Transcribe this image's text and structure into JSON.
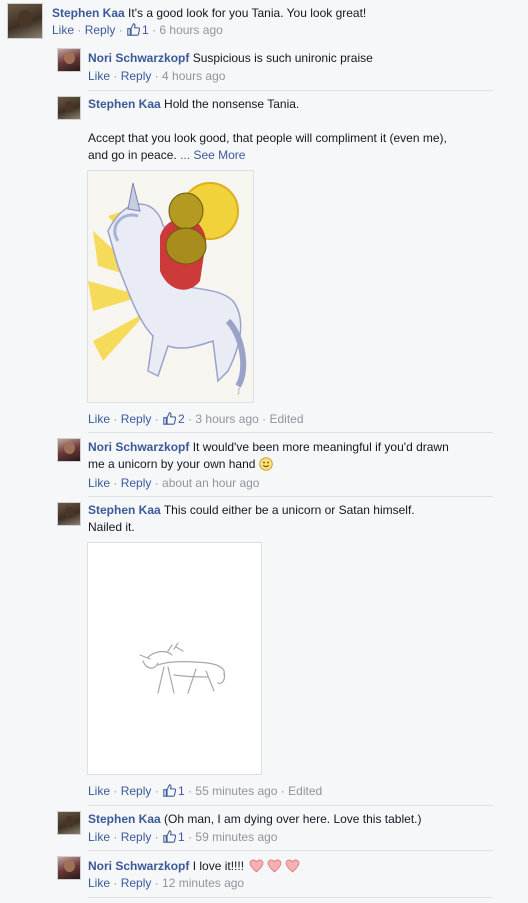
{
  "comments": [
    {
      "author": "Stephen Kaa",
      "text": "It's a good look for you Tania. You look great!",
      "like": "Like",
      "reply": "Reply",
      "likes": "1",
      "time": "6 hours ago"
    },
    {
      "author": "Nori Schwarzkopf",
      "text": "Suspicious is such unironic praise",
      "like": "Like",
      "reply": "Reply",
      "time": "4 hours ago"
    },
    {
      "author": "Stephen Kaa",
      "text": "Hold the nonsense Tania.",
      "text2": "Accept that you look good, that people will compliment it (even me),",
      "text3": "and go in peace.",
      "ellipsis": "...",
      "see_more": "See More",
      "like": "Like",
      "reply": "Reply",
      "likes": "2",
      "time": "3 hours ago",
      "edited": "Edited"
    },
    {
      "author": "Nori Schwarzkopf",
      "text": "It would've been more meaningful if you'd drawn",
      "text2": "me a unicorn by your own hand",
      "like": "Like",
      "reply": "Reply",
      "time": "about an hour ago"
    },
    {
      "author": "Stephen Kaa",
      "text": "This could either be a unicorn or Satan himself.",
      "text2": "Nailed it.",
      "like": "Like",
      "reply": "Reply",
      "likes": "1",
      "time": "55 minutes ago",
      "edited": "Edited"
    },
    {
      "author": "Stephen Kaa",
      "text": "(Oh man, I am dying over here. Love this tablet.)",
      "like": "Like",
      "reply": "Reply",
      "likes": "1",
      "time": "59 minutes ago"
    },
    {
      "author": "Nori Schwarzkopf",
      "text": "I love it!!!!",
      "like": "Like",
      "reply": "Reply",
      "time": "12 minutes ago"
    }
  ],
  "colors": {
    "link": "#3b5998",
    "meta": "#90949c",
    "heart": "#f0a0a0"
  },
  "icons": {
    "like": "thumbs-up-icon",
    "smile": "smiley-icon",
    "heart": "heart-icon"
  }
}
